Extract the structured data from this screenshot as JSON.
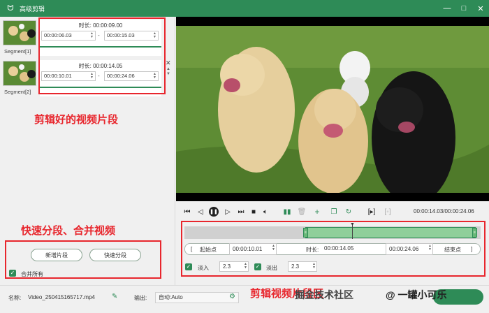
{
  "window": {
    "title": "高级剪辑",
    "minimize": "—",
    "maximize": "□",
    "close": "✕"
  },
  "segments": [
    {
      "label": "Segment[1]",
      "duration_label": "时长:",
      "duration": "00:00:09.00",
      "start": "00:00:06.03",
      "end": "00:00:15.03"
    },
    {
      "label": "Segment[2]",
      "duration_label": "时长:",
      "duration": "00:00:14.05",
      "start": "00:00:10.01",
      "end": "00:00:24.06"
    }
  ],
  "annotations": {
    "clips": "剪辑好的视频片段",
    "split_merge": "快速分段、合并视频",
    "edit_area": "剪辑视频片段区"
  },
  "left_buttons": {
    "add_segment": "新增片段",
    "quick_split": "快速分段",
    "merge_all": "合并所有"
  },
  "player": {
    "time_readout": "00:00:14.03/00:00:24.06"
  },
  "edit": {
    "start_label": "起始点",
    "start_value": "00:00:10.01",
    "duration_label": "时长:",
    "duration_value": "00:00:14.05",
    "end_value": "00:00:24.06",
    "end_label": "结束点",
    "fade_in_label": "淡入",
    "fade_in_value": "2.3",
    "fade_out_label": "淡出",
    "fade_out_value": "2.3",
    "bracket_left": "[",
    "bracket_right": "]"
  },
  "bottom": {
    "name_label": "名称:",
    "name_value": "Video_250415165717.mp4",
    "output_label": "输出:",
    "output_value": "自动:Auto"
  },
  "watermark": {
    "text1": "掘金技术社区",
    "text2": "@ 一罐小可乐"
  },
  "colors": {
    "brand": "#2e8b57",
    "annotation": "#e8262d"
  }
}
